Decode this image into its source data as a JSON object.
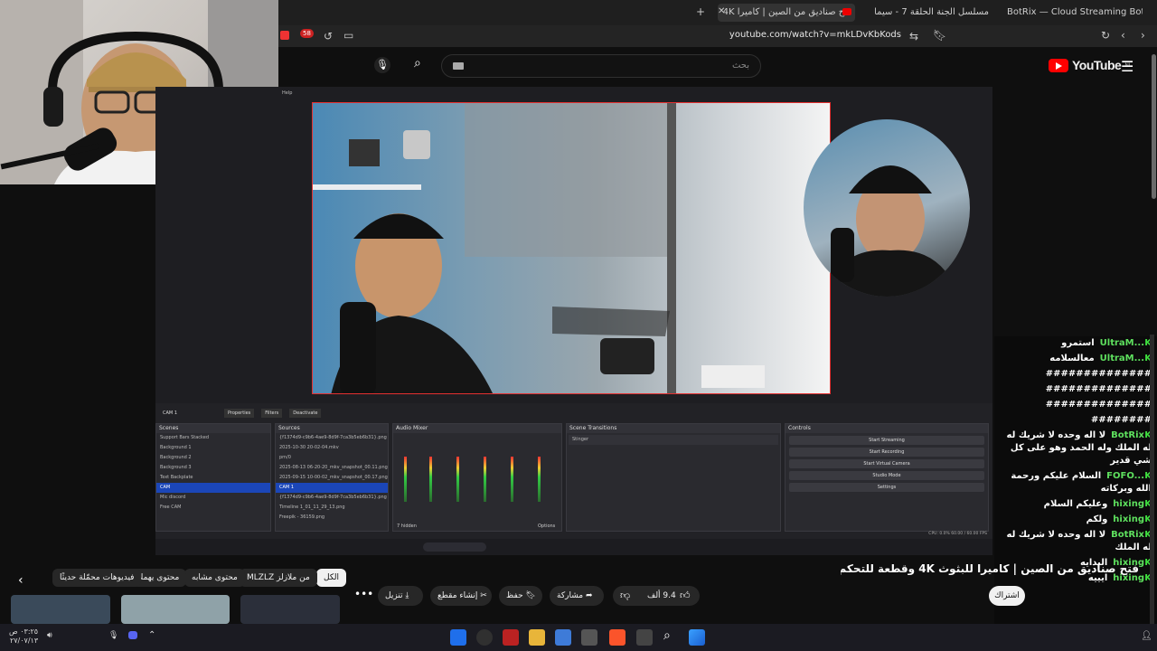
{
  "browser": {
    "tabs": [
      {
        "label": "فتح صناديق من الصين | كاميرا 4K"
      },
      {
        "label": "مسلسل الجنة الحلقة 7 - سيما ماكس"
      },
      {
        "label": "BotRix — Cloud Streaming Bot for Twitch"
      }
    ],
    "url": "youtube.com/watch?v=mkLDvKbKods",
    "badge_count": "58"
  },
  "youtube": {
    "logo": "YouTube",
    "region": "NL",
    "search_placeholder": "بحث"
  },
  "obs": {
    "scene_name": "CAM 1",
    "toolbar": {
      "properties": "Properties",
      "filters": "Filters",
      "deactivate": "Deactivate"
    },
    "docks": {
      "scenes": "Scenes",
      "sources": "Sources",
      "audio": "Audio Mixer",
      "transitions": "Scene Transitions",
      "controls": "Controls"
    },
    "scenes": [
      "Support Bars Stacked",
      "Background 1",
      "Background 2",
      "Background 3",
      "Text Backplate",
      "CAM",
      "Mic discord",
      "Free CAM"
    ],
    "sources": [
      "{f1374d9-c9b6-4ae9-8d9f-7ca3b5eb6b31}.png",
      "2025-10-30 20-02-04.mkv",
      "pm/0",
      "2025-08-13 06-20-20_mkv_snapshot_00.11.png",
      "2025-09-15 10-00-02_mkv_snapshot_00.17.png",
      "CAM 1",
      "{f1374d9-c9b6-4ae9-8d9f-7ca3b5eb6b31}.png",
      "Timeline 1_01_11_29_13.png",
      "Freepik - 36159.png"
    ],
    "transition": "Stinger",
    "controls": [
      "Start Streaming",
      "Start Recording",
      "Start Virtual Camera",
      "Studio Mode",
      "Settings"
    ],
    "audio_hidden": "7 hidden",
    "audio_options": "Options",
    "status": "CPU: 0.0%   60.00 / 60.00 FPS"
  },
  "chat": [
    {
      "user": "UltraM...",
      "text": "استمرو"
    },
    {
      "user": "UltraM...",
      "text": "معالسلامه"
    },
    {
      "user": "",
      "text": "##############"
    },
    {
      "user": "",
      "text": "##############"
    },
    {
      "user": "",
      "text": "##############"
    },
    {
      "user": "",
      "text": "########"
    },
    {
      "user": "BotRix",
      "text": "لا اله وحده لا شريك له له الملك وله الحمد وهو على كل شي قدير"
    },
    {
      "user": "FOFO...",
      "text": "السلام عليكم ورحمة الله وبركاته"
    },
    {
      "user": "hixing",
      "text": "وعليكم السلام"
    },
    {
      "user": "hixing",
      "text": "ولكم"
    },
    {
      "user": "BotRix",
      "text": "لا اله وحده لا شريك له له الملك"
    },
    {
      "user": "hixing",
      "text": "البدايه"
    },
    {
      "user": "hixing",
      "text": "ايييه"
    }
  ],
  "below": {
    "title": "فتح صناديق من الصين | كاميرا للبثوث 4K وقطعة للتحكم بالبي سي",
    "chips": [
      "الكل",
      "من ملازلز MLZLZ",
      "محتوى مشابه",
      "محتوى يهمك",
      "فيديوهات محمّلة حديثًا"
    ],
    "likes": "9.4 ألف",
    "share": "مشاركة",
    "save": "حفظ",
    "clip": "إنشاء مقطع",
    "download": "تنزيل",
    "subscribe": "اشتراك"
  },
  "taskbar": {
    "time": "٠٣:٢٥ ص",
    "date": "٢٧/٠٧/١٣"
  }
}
